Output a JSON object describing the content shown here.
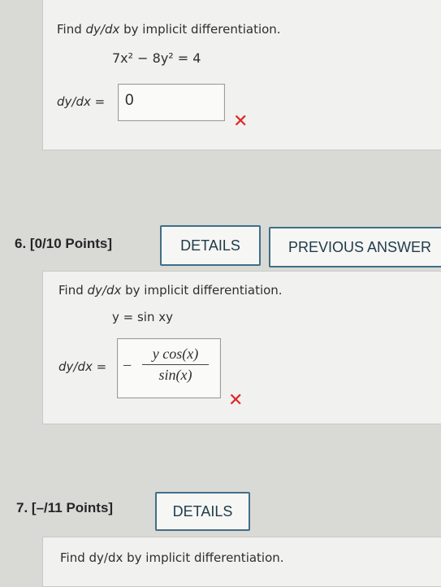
{
  "q5": {
    "instruction_pre": "Find ",
    "instruction_var": "dy/dx",
    "instruction_post": " by implicit differentiation.",
    "equation": "7x² − 8y² = 4",
    "answer_label": "dy/dx =",
    "answer_value": "0",
    "status_icon": "cross-mark-icon"
  },
  "q6": {
    "number": "6.",
    "points": "[0/10 Points]",
    "details_label": "DETAILS",
    "previous_label": "PREVIOUS ANSWER",
    "instruction_pre": "Find ",
    "instruction_var": "dy/dx",
    "instruction_post": " by implicit differentiation.",
    "equation": "y = sin xy",
    "answer_label": "dy/dx =",
    "answer_sign": "−",
    "answer_numerator": "y cos(x)",
    "answer_denominator": "sin(x)",
    "status_icon": "cross-mark-icon"
  },
  "q7": {
    "number": "7.",
    "points": "[–/11 Points]",
    "details_label": "DETAILS",
    "instruction": "Find dy/dx by implicit differentiation."
  },
  "colors": {
    "error_mark": "#e02424",
    "button_border": "#3f6f86",
    "card_bg": "#f1f1ef",
    "page_bg": "#d9d9d6"
  }
}
